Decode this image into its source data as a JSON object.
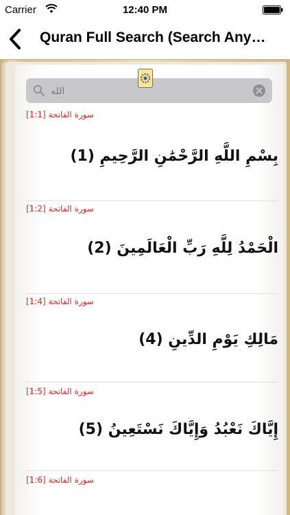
{
  "status_bar": {
    "carrier": "Carrier",
    "time": "12:40 PM"
  },
  "nav": {
    "title": "Quran Full Search (Search Any…"
  },
  "search": {
    "query": "الله"
  },
  "results": [
    {
      "ref": "[1:1]",
      "surah": "سورة الفاتحة",
      "verse": "بِسْمِ اللَّهِ الرَّحْمَٰنِ الرَّحِيمِ (1)"
    },
    {
      "ref": "[1:2]",
      "surah": "سورة الفاتحة",
      "verse": "الْحَمْدُ لِلَّهِ رَبِّ الْعَالَمِينَ (2)"
    },
    {
      "ref": "[1:4]",
      "surah": "سورة الفاتحة",
      "verse": "مَالِكِ يَوْمِ الدِّينِ (4)"
    },
    {
      "ref": "[1:5]",
      "surah": "سورة الفاتحة",
      "verse": "إِيَّاكَ نَعْبُدُ وَإِيَّاكَ نَسْتَعِينُ (5)"
    },
    {
      "ref": "[1:6]",
      "surah": "سورة الفاتحة",
      "verse": ""
    }
  ],
  "icons": {
    "wifi": "wifi-icon",
    "battery": "battery-icon",
    "back": "chevron-left-icon",
    "search": "search-icon",
    "clear": "clear-icon",
    "settings": "gear-icon"
  },
  "colors": {
    "reference": "#e8202a",
    "search_bg": "#c7c7cc",
    "page_bg": "#ffffff"
  }
}
